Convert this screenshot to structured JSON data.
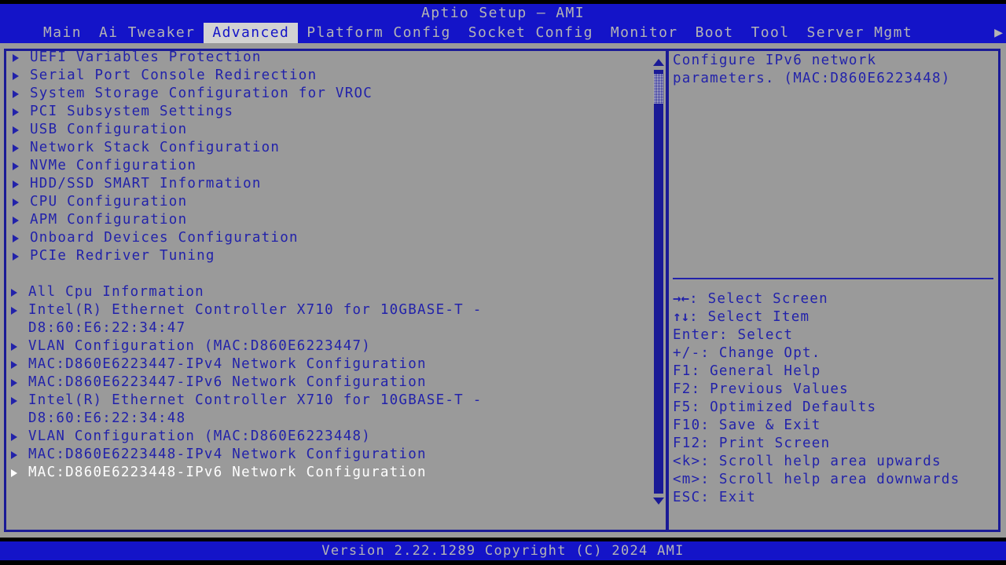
{
  "window": {
    "title": "Aptio Setup – AMI",
    "version_bar": "Version 2.22.1289 Copyright (C) 2024 AMI"
  },
  "menubar": {
    "tabs": [
      {
        "label": "Main",
        "active": false
      },
      {
        "label": "Ai Tweaker",
        "active": false
      },
      {
        "label": "Advanced",
        "active": true
      },
      {
        "label": "Platform Config",
        "active": false
      },
      {
        "label": "Socket Config",
        "active": false
      },
      {
        "label": "Monitor",
        "active": false
      },
      {
        "label": "Boot",
        "active": false
      },
      {
        "label": "Tool",
        "active": false
      },
      {
        "label": "Server Mgmt",
        "active": false
      }
    ],
    "more_indicator": "▶"
  },
  "left_panel": {
    "items": [
      {
        "label": "UEFI Variables Protection",
        "type": "submenu",
        "group": 1,
        "selected": false
      },
      {
        "label": "Serial Port Console Redirection",
        "type": "submenu",
        "group": 1,
        "selected": false
      },
      {
        "label": "System Storage Configuration for VROC",
        "type": "submenu",
        "group": 1,
        "selected": false
      },
      {
        "label": "PCI Subsystem Settings",
        "type": "submenu",
        "group": 1,
        "selected": false
      },
      {
        "label": "USB Configuration",
        "type": "submenu",
        "group": 1,
        "selected": false
      },
      {
        "label": "Network Stack Configuration",
        "type": "submenu",
        "group": 1,
        "selected": false
      },
      {
        "label": "NVMe Configuration",
        "type": "submenu",
        "group": 1,
        "selected": false
      },
      {
        "label": "HDD/SSD SMART Information",
        "type": "submenu",
        "group": 1,
        "selected": false
      },
      {
        "label": "CPU Configuration",
        "type": "submenu",
        "group": 1,
        "selected": false
      },
      {
        "label": "APM Configuration",
        "type": "submenu",
        "group": 1,
        "selected": false
      },
      {
        "label": "Onboard Devices Configuration",
        "type": "submenu",
        "group": 1,
        "selected": false
      },
      {
        "label": "PCIe Redriver Tuning",
        "type": "submenu",
        "group": 1,
        "selected": false
      },
      {
        "label": "",
        "type": "spacer",
        "group": 1,
        "selected": false
      },
      {
        "label": "All Cpu Information",
        "type": "submenu",
        "group": 2,
        "selected": false
      },
      {
        "label": "Intel(R) Ethernet Controller X710 for 10GBASE-T -",
        "type": "submenu",
        "group": 2,
        "selected": false
      },
      {
        "label": "D8:60:E6:22:34:47",
        "type": "continuation",
        "group": 2,
        "selected": false
      },
      {
        "label": "VLAN Configuration (MAC:D860E6223447)",
        "type": "submenu",
        "group": 2,
        "selected": false
      },
      {
        "label": "MAC:D860E6223447-IPv4 Network Configuration",
        "type": "submenu",
        "group": 2,
        "selected": false
      },
      {
        "label": "MAC:D860E6223447-IPv6 Network Configuration",
        "type": "submenu",
        "group": 2,
        "selected": false
      },
      {
        "label": "Intel(R) Ethernet Controller X710 for 10GBASE-T -",
        "type": "submenu",
        "group": 2,
        "selected": false
      },
      {
        "label": "D8:60:E6:22:34:48",
        "type": "continuation",
        "group": 2,
        "selected": false
      },
      {
        "label": "VLAN Configuration (MAC:D860E6223448)",
        "type": "submenu",
        "group": 2,
        "selected": false
      },
      {
        "label": "MAC:D860E6223448-IPv4 Network Configuration",
        "type": "submenu",
        "group": 2,
        "selected": false
      },
      {
        "label": "MAC:D860E6223448-IPv6 Network Configuration",
        "type": "submenu",
        "group": 2,
        "selected": true
      }
    ],
    "scrollbar": {
      "up_arrow": "▲",
      "down_arrow": "▼"
    }
  },
  "right_panel": {
    "help_lines": [
      "Configure IPv6 network",
      "parameters. (MAC:D860E6223448)"
    ],
    "key_legend": [
      {
        "glyph": "→←",
        "text": ": Select Screen"
      },
      {
        "glyph": "↑↓",
        "text": ": Select Item"
      },
      {
        "glyph": "",
        "text": "Enter: Select"
      },
      {
        "glyph": "",
        "text": "+/-: Change Opt."
      },
      {
        "glyph": "",
        "text": "F1: General Help"
      },
      {
        "glyph": "",
        "text": "F2: Previous Values"
      },
      {
        "glyph": "",
        "text": "F5: Optimized Defaults"
      },
      {
        "glyph": "",
        "text": "F10: Save & Exit"
      },
      {
        "glyph": "",
        "text": "F12: Print Screen"
      },
      {
        "glyph": "",
        "text": "<k>: Scroll help area upwards"
      },
      {
        "glyph": "",
        "text": "<m>: Scroll help area downwards"
      },
      {
        "glyph": "",
        "text": "ESC: Exit"
      }
    ]
  },
  "colors": {
    "header_blue": "#1414c8",
    "border_blue": "#1a1a96",
    "text_blue": "#2222aa",
    "panel_gray": "#9a9a9a",
    "header_text": "#b4b4b4",
    "active_tab_bg": "#d2d2d2",
    "selected_text": "#ffffff"
  }
}
